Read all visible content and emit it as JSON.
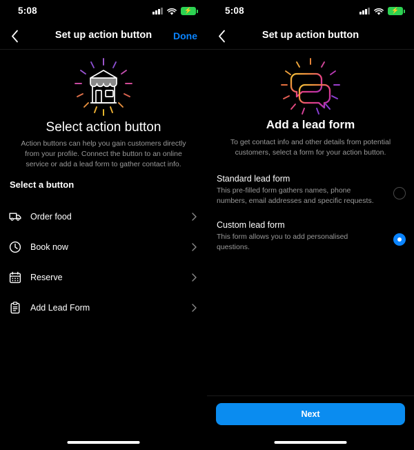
{
  "status_bar": {
    "time": "5:08",
    "signal_icon": "cellular-signal-icon",
    "wifi_icon": "wifi-icon",
    "battery_icon": "battery-charging-icon",
    "battery_color": "#2dd252"
  },
  "left_panel": {
    "nav": {
      "back_icon": "chevron-left-icon",
      "title": "Set up action button",
      "done_label": "Done",
      "done_color": "#0a84ff"
    },
    "hero_icon": "storefront-illustration",
    "heading": "Select action button",
    "subheading": "Action buttons can help you gain customers directly from your profile. Connect the button to an online service or add a lead form to gather contact info.",
    "section_label": "Select a button",
    "items": [
      {
        "label": "Order food",
        "icon": "delivery-truck-icon",
        "chevron": "chevron-right-icon"
      },
      {
        "label": "Book now",
        "icon": "clock-icon",
        "chevron": "chevron-right-icon"
      },
      {
        "label": "Reserve",
        "icon": "calendar-icon",
        "chevron": "chevron-right-icon"
      },
      {
        "label": "Add Lead Form",
        "icon": "clipboard-icon",
        "chevron": "chevron-right-icon"
      }
    ]
  },
  "right_panel": {
    "nav": {
      "back_icon": "chevron-left-icon",
      "title": "Set up action button"
    },
    "hero_icon": "speech-bubbles-illustration",
    "heading": "Add a lead form",
    "subheading": "To get contact info and other details from potential customers, select a form for your action button.",
    "options": [
      {
        "title": "Standard lead form",
        "description": "This pre-filled form gathers names, phone numbers, email addresses and specific requests.",
        "selected": false
      },
      {
        "title": "Custom lead form",
        "description": "This form allows you to add personalised questions.",
        "selected": true
      }
    ],
    "next_label": "Next",
    "next_color": "#0a8cf0"
  },
  "theme": {
    "background": "#000000",
    "text_primary": "#ffffff",
    "text_secondary": "#9a9a9a",
    "accent": "#0a84ff"
  }
}
